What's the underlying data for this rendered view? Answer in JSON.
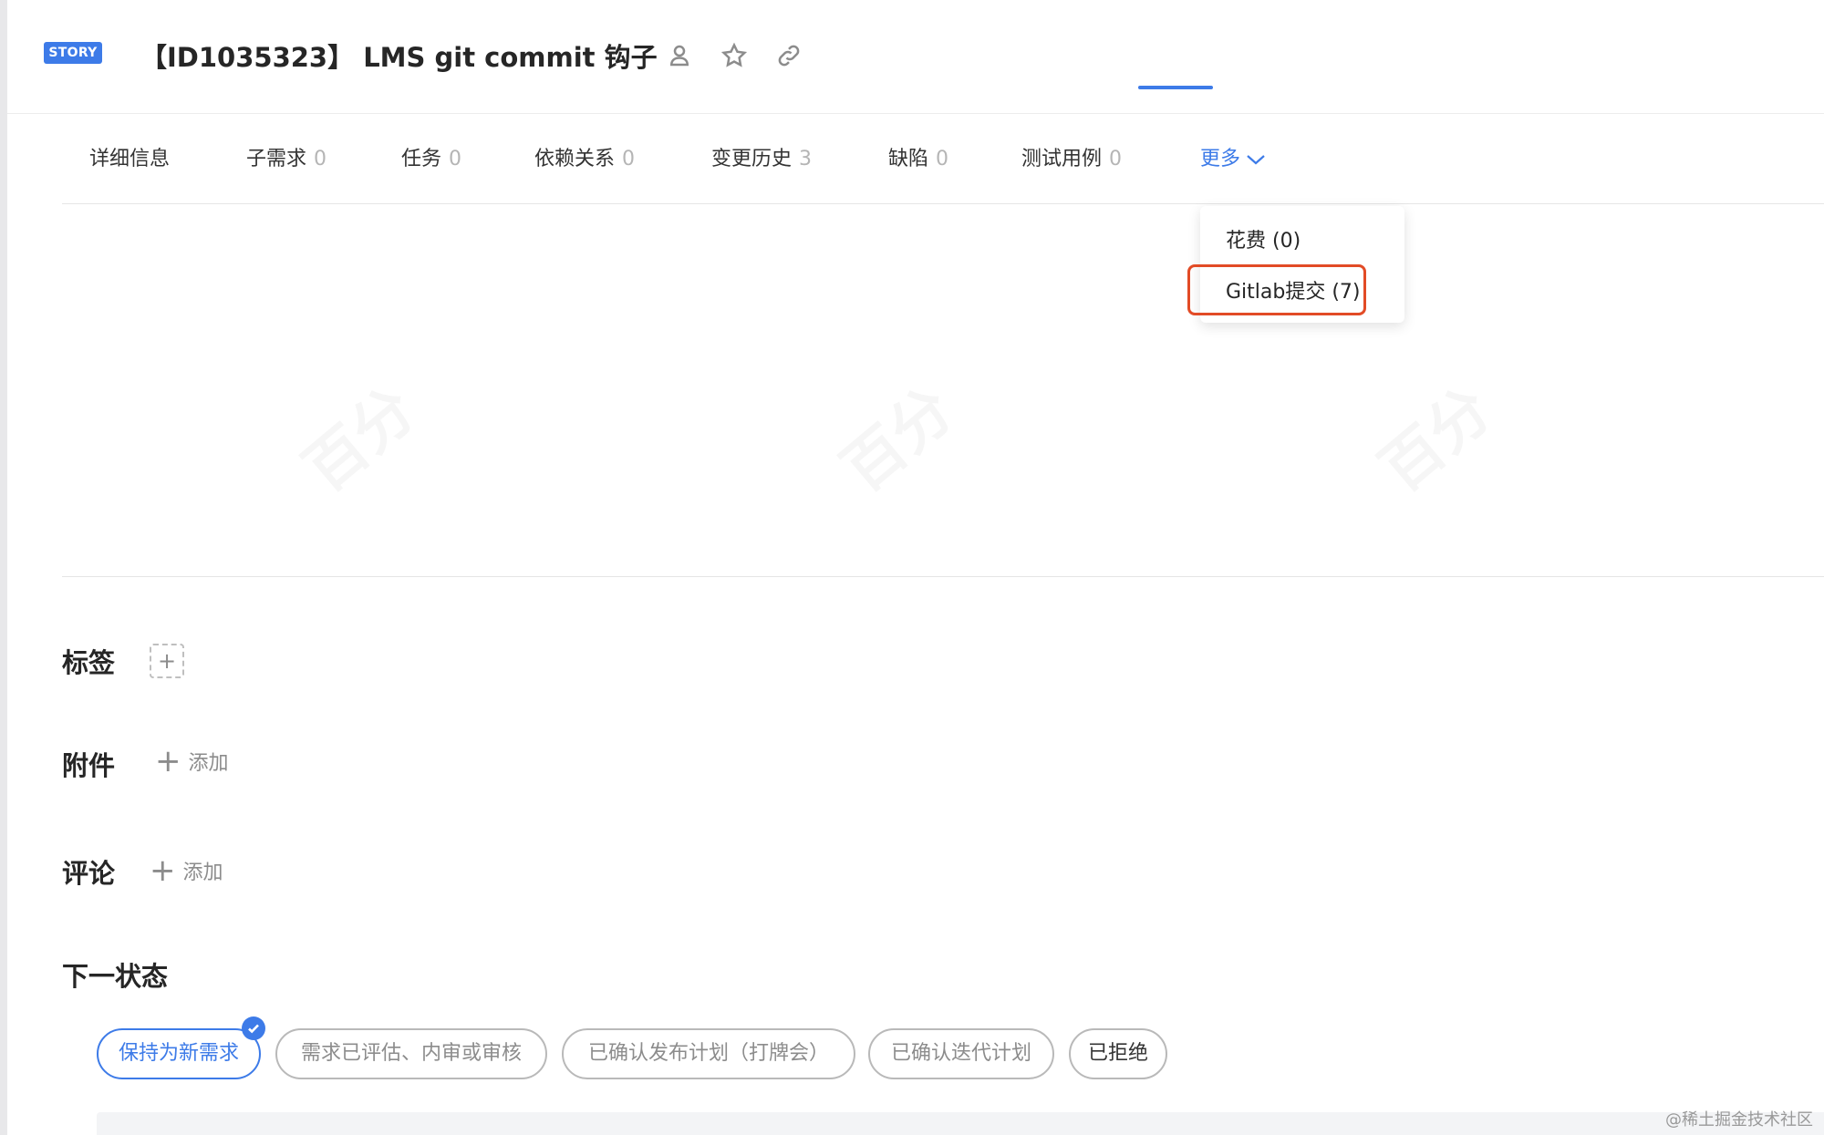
{
  "header": {
    "badge": "STORY",
    "title": "【ID1035323】 LMS git commit 钩子"
  },
  "tabs": [
    {
      "label": "详细信息",
      "count": ""
    },
    {
      "label": "子需求",
      "count": "0"
    },
    {
      "label": "任务",
      "count": "0"
    },
    {
      "label": "依赖关系",
      "count": "0"
    },
    {
      "label": "变更历史",
      "count": "3"
    },
    {
      "label": "缺陷",
      "count": "0"
    },
    {
      "label": "测试用例",
      "count": "0"
    },
    {
      "label": "更多",
      "count": ""
    }
  ],
  "dropdown": {
    "items": [
      "花费 (0)",
      "Gitlab提交 (7)"
    ]
  },
  "sections": {
    "tags": "标签",
    "attachments": "附件",
    "attachments_add": "添加",
    "comments": "评论",
    "comments_add": "添加",
    "next_status": "下一状态"
  },
  "statuses": [
    {
      "label": "保持为新需求"
    },
    {
      "label": "需求已评估、内审或审核"
    },
    {
      "label": "已确认发布计划（打牌会）"
    },
    {
      "label": "已确认迭代计划"
    },
    {
      "label": "已拒绝"
    }
  ],
  "watermark": "百分",
  "credit": "@稀土掘金技术社区",
  "colors": {
    "accent": "#3d7be8",
    "highlight": "#e24b26"
  }
}
